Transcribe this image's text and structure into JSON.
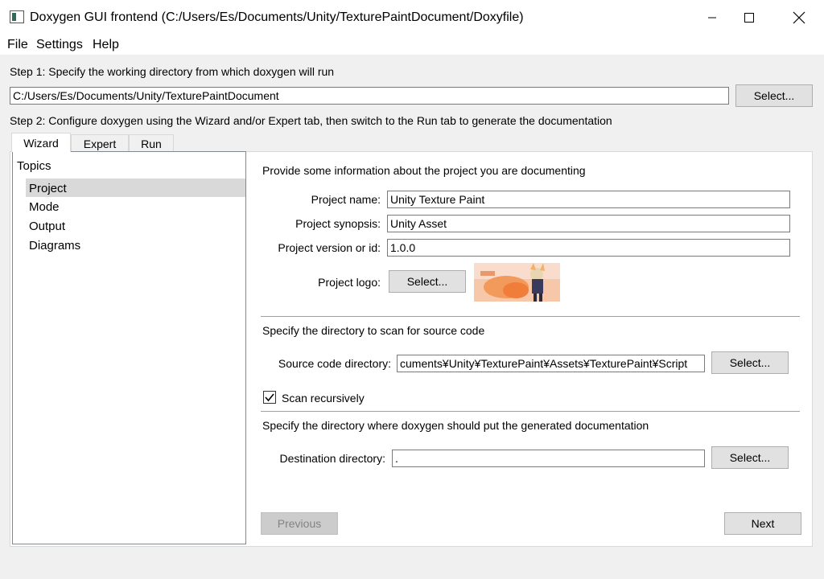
{
  "window": {
    "title": "Doxygen GUI frontend (C:/Users/Es/Documents/Unity/TexturePaintDocument/Doxyfile)",
    "controls": [
      "minimize-icon",
      "maximize-icon",
      "close-icon"
    ]
  },
  "menu": {
    "file": "File",
    "settings": "Settings",
    "help": "Help"
  },
  "step1": {
    "label": "Step 1: Specify the working directory from which doxygen will run",
    "directory": "C:/Users/Es/Documents/Unity/TexturePaintDocument",
    "select_label": "Select..."
  },
  "step2": {
    "label": "Step 2: Configure doxygen using the Wizard and/or Expert tab, then switch to the Run tab to generate the documentation"
  },
  "tabs": [
    "Wizard",
    "Expert",
    "Run"
  ],
  "topics": {
    "header": "Topics",
    "items": [
      "Project",
      "Mode",
      "Output",
      "Diagrams"
    ],
    "selected": "Project"
  },
  "project": {
    "intro": "Provide some information about the project you are documenting",
    "name_label": "Project name:",
    "name_value": "Unity Texture Paint",
    "synopsis_label": "Project synopsis:",
    "synopsis_value": "Unity Asset",
    "version_label": "Project version or id:",
    "version_value": "1.0.0",
    "logo_label": "Project logo:",
    "logo_select": "Select..."
  },
  "source": {
    "intro": "Specify the directory to scan for source code",
    "dir_label": "Source code directory:",
    "dir_value": "cuments¥Unity¥TexturePaint¥Assets¥TexturePaint¥Script",
    "select_label": "Select...",
    "recursive_label": "Scan recursively",
    "recursive_checked": true
  },
  "destination": {
    "intro": "Specify the directory where doxygen should put the generated documentation",
    "dir_label": "Destination directory:",
    "dir_value": ".",
    "select_label": "Select..."
  },
  "nav": {
    "previous": "Previous",
    "next": "Next"
  },
  "colors": {
    "selection": "#d9d9d9",
    "accent": "#f0a070"
  }
}
